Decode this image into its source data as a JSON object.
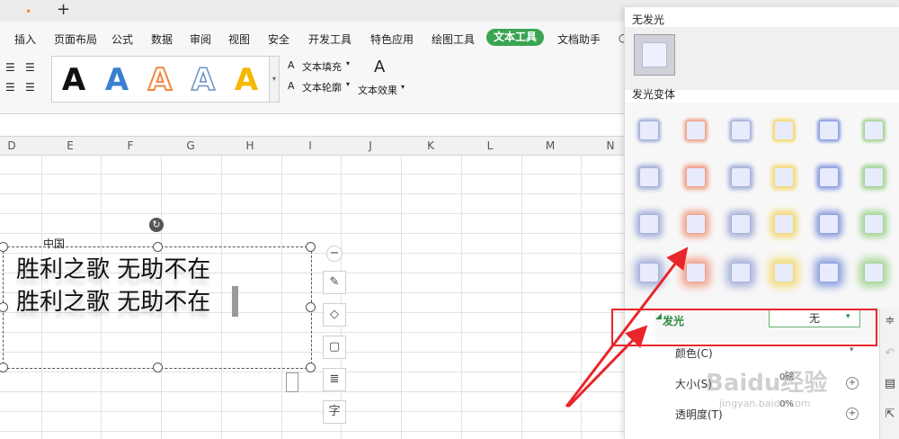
{
  "titlebar": {
    "dot": "•",
    "new_tab": "+"
  },
  "menu": {
    "items": [
      "插入",
      "页面布局",
      "公式",
      "数据",
      "审阅",
      "视图",
      "安全",
      "开发工具",
      "特色应用",
      "绘图工具",
      "文本工具",
      "文档助手"
    ],
    "active": "文本工具"
  },
  "ribbon": {
    "text_fill": "文本填充",
    "text_outline": "文本轮廓",
    "text_effect": "文本效果",
    "style_letter": "A",
    "style_colors": [
      "#111111",
      "#3b7fd0",
      "#f0883e",
      "#ffffff",
      "#f5b800"
    ]
  },
  "sheet": {
    "columns": [
      "D",
      "E",
      "F",
      "G",
      "H",
      "I",
      "J",
      "K",
      "L",
      "M",
      "N"
    ],
    "cell_text": "中国"
  },
  "textbox": {
    "line1": "胜利之歌 无助不在",
    "line2": "胜利之歌 无助不在"
  },
  "panel": {
    "no_glow_title": "无发光",
    "variant_title": "发光变体",
    "variant_colors": [
      "#a8b3da",
      "#f0a58f",
      "#a8b3da",
      "#f2dc7a",
      "#8fa1df",
      "#a7d59a"
    ],
    "glow_label": "发光",
    "glow_value": "无",
    "color_label": "颜色(C)",
    "size_label": "大小(S)",
    "transparency_label": "透明度(T)",
    "size_value": "0磅",
    "transparency_value": "0%"
  },
  "watermark": {
    "text": "Baidu经验",
    "url": "jingyan.baidu.com"
  },
  "colors": {
    "accent_green": "#3aa452",
    "highlight_red": "#e8262b"
  }
}
